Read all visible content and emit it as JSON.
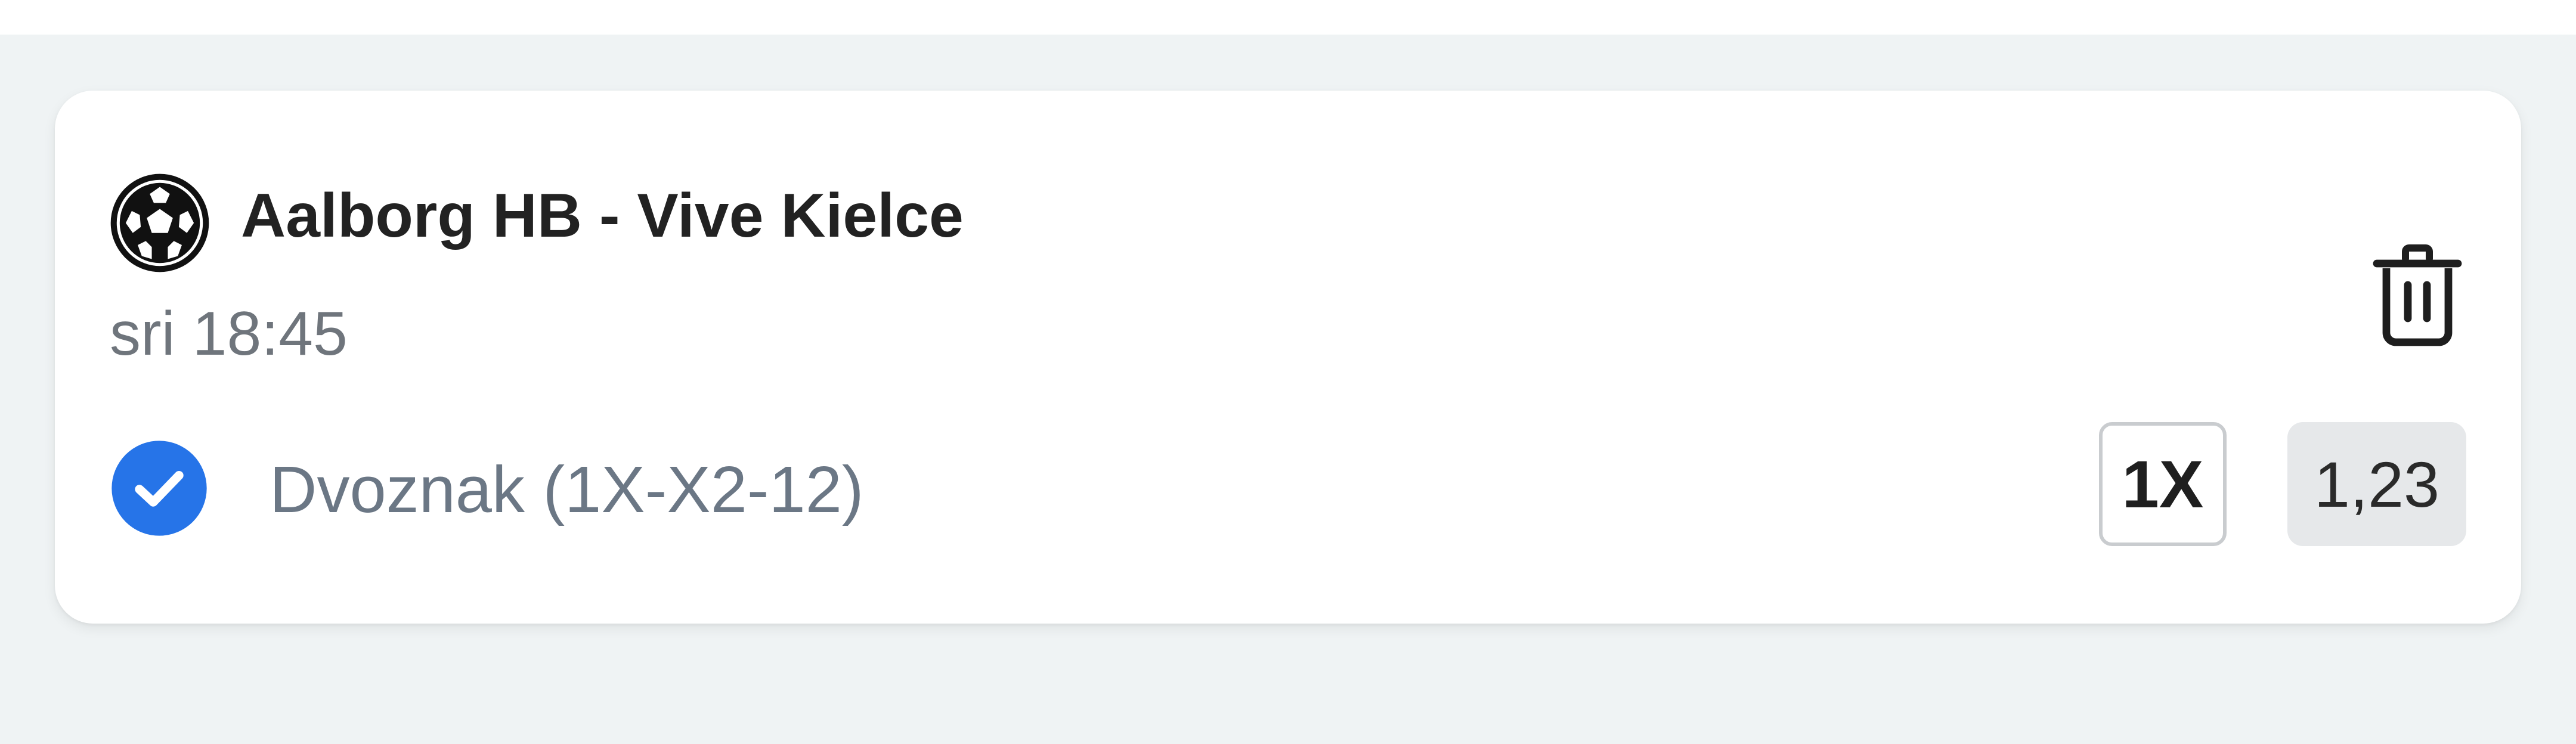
{
  "ticket": {
    "event": {
      "sport_icon": "handball-ball-icon",
      "title": "Aalborg HB - Vive Kielce",
      "time": "sri 18:45"
    },
    "selection": {
      "status_icon": "check-circle-icon",
      "market": "Dvoznak (1X-X2-12)",
      "pick": "1X",
      "odds": "1,23"
    },
    "actions": {
      "delete_icon": "trash-icon"
    }
  },
  "colors": {
    "page_background": "#eff3f4",
    "card_background": "#ffffff",
    "accent_blue": "#2674e8",
    "odds_background": "#e6e8ea"
  }
}
